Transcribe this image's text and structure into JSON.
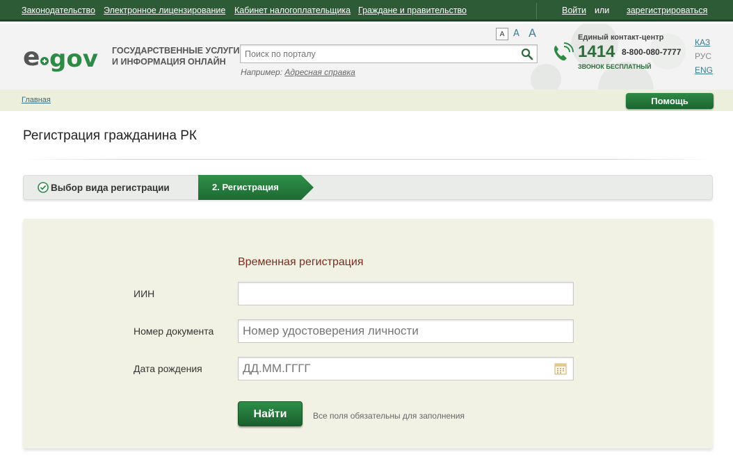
{
  "topnav": {
    "links": [
      "Законодательство",
      "Электронное лицензирование",
      "Кабинет налогоплательщика",
      "Граждане и правительство"
    ],
    "login": "Войти",
    "or": "или",
    "register": "зарегистрироваться"
  },
  "header": {
    "logo_text": "egov",
    "tagline_line1": "Государственные услуги",
    "tagline_line2": "и информация онлайн",
    "font_sizes": [
      "A",
      "A",
      "A"
    ],
    "search_placeholder": "Поиск по порталу",
    "example_prefix": "Например:",
    "example_link": "Адресная справка",
    "contact_label": "Единый контакт-центр",
    "phone_short": "1414",
    "phone_long": "8-800-080-7777",
    "phone_free": "звонок бесплатный",
    "languages": [
      "КАЗ",
      "РУС",
      "ENG"
    ],
    "active_language": "РУС"
  },
  "breadcrumb": {
    "home": "Главная",
    "help_button": "Помощь"
  },
  "page": {
    "title": "Регистрация гражданина РК"
  },
  "steps": {
    "step1": "Выбор вида регистрации",
    "step2": "2. Регистрация"
  },
  "form": {
    "title": "Временная регистрация",
    "iin_label": "ИИН",
    "iin_value": "",
    "doc_label": "Номер документа",
    "doc_placeholder": "Номер удостоверения личности",
    "dob_label": "Дата рождения",
    "dob_placeholder": "ДД.ММ.ГГГГ",
    "submit": "Найти",
    "hint": "Все поля обязательны для заполнения"
  },
  "colors": {
    "topbar": "#2c5b36",
    "accent_green": "#1c6530",
    "form_title": "#7a2d1e",
    "panel_bg": "#f1f2e4"
  }
}
